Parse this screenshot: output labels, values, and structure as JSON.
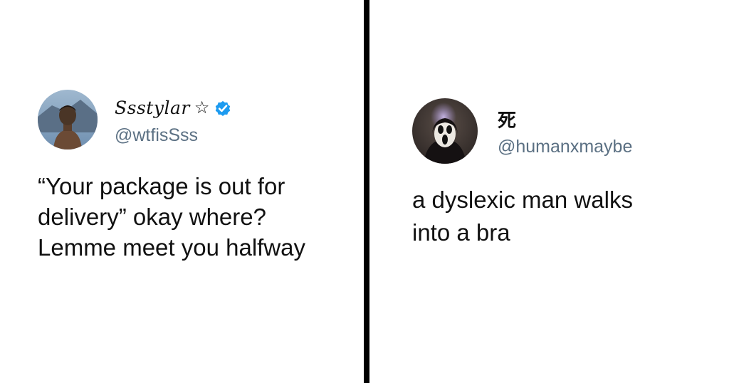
{
  "tweets": [
    {
      "display_name": "Ssstylar",
      "handle": "@wtfisSss",
      "text_lines": [
        "“Your package is out for",
        "delivery” okay where?",
        "Lemme meet you halfway"
      ],
      "avatar_icon": "profile-photo-man-icon",
      "verified": true,
      "verified_color": "#1d9bf0"
    },
    {
      "display_name": "死",
      "handle": "@humanxmaybe",
      "text_lines": [
        "a dyslexic man walks",
        "into a bra"
      ],
      "avatar_icon": "profile-photo-ghostface-icon",
      "verified": false
    }
  ],
  "colors": {
    "text": "#111111",
    "handle": "#5b7083",
    "divider": "#000000",
    "background": "#ffffff"
  }
}
